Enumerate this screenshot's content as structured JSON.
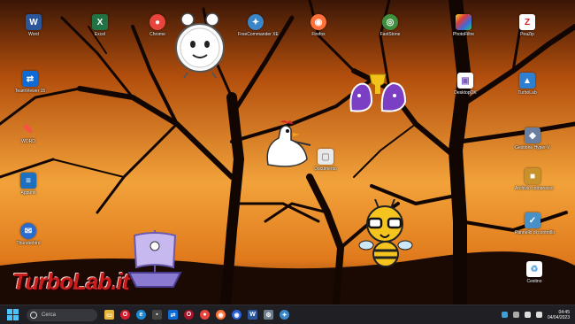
{
  "desktop": {
    "icons": [
      {
        "name": "word-icon",
        "label": "Word",
        "glyph": "W",
        "color": "#2b579a"
      },
      {
        "name": "excel-icon",
        "label": "Excel",
        "glyph": "X",
        "color": "#217346"
      },
      {
        "name": "chrome-icon",
        "label": "Chrome",
        "glyph": "●",
        "color": "#e8453c"
      },
      {
        "name": "freecommander-icon",
        "label": "FreeCommander XE",
        "glyph": "✦",
        "color": "#3a86c8"
      },
      {
        "name": "firefox-icon",
        "label": "Firefox",
        "glyph": "◉",
        "color": "#ff7139"
      },
      {
        "name": "faststone-icon",
        "label": "FastStone",
        "glyph": "◎",
        "color": "#3e8f3e"
      },
      {
        "name": "photofiltre-icon",
        "label": "PhotoFiltre",
        "glyph": "▦",
        "color": "#c93aa1"
      },
      {
        "name": "7zip-icon",
        "label": "PeaZip",
        "glyph": "Z",
        "color": "#d01a22"
      },
      {
        "name": "teamviewer-icon",
        "label": "TeamViewer 15",
        "glyph": "⇄",
        "color": "#0e6bd6"
      },
      {
        "name": "desktopok-icon",
        "label": "DesktopOK",
        "glyph": "▣",
        "color": "#7d5fc0"
      },
      {
        "name": "turbolab-icon",
        "label": "TurboLab",
        "glyph": "▲",
        "color": "#2f7fd0"
      },
      {
        "name": "wordpad-icon",
        "label": "WORD",
        "glyph": "✎",
        "color": "#e04040"
      },
      {
        "name": "hyperv-icon",
        "label": "Gestione Hyper-V",
        "glyph": "◆",
        "color": "#6a7fa0"
      },
      {
        "name": "notes-icon",
        "label": "Appunti",
        "glyph": "≡",
        "color": "#1d6fbf"
      },
      {
        "name": "archive-icon",
        "label": "Archivio compresso",
        "glyph": "■",
        "color": "#c9912b"
      },
      {
        "name": "documents-icon",
        "label": "Documento",
        "glyph": "▢",
        "color": "#d8d8d8"
      },
      {
        "name": "thunderbird-icon",
        "label": "Thunderbird",
        "glyph": "✉",
        "color": "#2a6bd1"
      },
      {
        "name": "control-icon",
        "label": "Pannello di controllo",
        "glyph": "✓",
        "color": "#4a90c8"
      },
      {
        "name": "recycle-bin-icon",
        "label": "Cestino",
        "glyph": "♻",
        "color": "#5ea8e0"
      }
    ]
  },
  "watermark": "TurboLab.it",
  "taskbar": {
    "search_placeholder": "Cerca",
    "apps": [
      {
        "name": "file-explorer-icon",
        "glyph": "▭",
        "color": "#e6b53c"
      },
      {
        "name": "opera-icon",
        "glyph": "O",
        "color": "#d61c2c"
      },
      {
        "name": "edge-icon",
        "glyph": "e",
        "color": "#1b8ad3"
      },
      {
        "name": "terminal-icon",
        "glyph": "▪",
        "color": "#444"
      },
      {
        "name": "teamviewer-task-icon",
        "glyph": "⇄",
        "color": "#0e6bd6"
      },
      {
        "name": "opera-gx-icon",
        "glyph": "O",
        "color": "#a8142a"
      },
      {
        "name": "chrome-task-icon",
        "glyph": "●",
        "color": "#e8453c"
      },
      {
        "name": "firefox-task-icon",
        "glyph": "◉",
        "color": "#ff7139"
      },
      {
        "name": "firefox-dev-icon",
        "glyph": "◉",
        "color": "#2a5fd6"
      },
      {
        "name": "word-task-icon",
        "glyph": "W",
        "color": "#2b579a"
      },
      {
        "name": "settings-task-icon",
        "glyph": "⚙",
        "color": "#6f7c8c"
      },
      {
        "name": "freecommander-task-icon",
        "glyph": "✦",
        "color": "#3a86c8"
      }
    ],
    "clock_time": "04:45",
    "clock_date": "04/04/2023"
  }
}
